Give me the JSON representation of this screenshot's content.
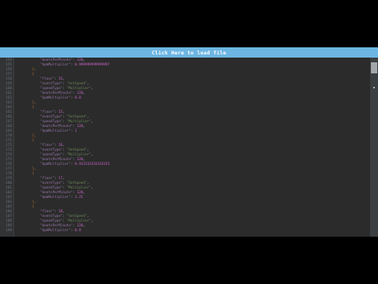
{
  "load_bar": {
    "label": "Click Here to load file"
  },
  "code_lines": [
    {
      "n": "154",
      "t": "            \"beatsPerMinute\": 120,"
    },
    {
      "n": "155",
      "t": "            \"bpmMultiplier\": 0.999999999999997"
    },
    {
      "n": "156",
      "t": "        },"
    },
    {
      "n": "157",
      "t": "        {"
    },
    {
      "n": "158",
      "t": "            \"floor\": 15,"
    },
    {
      "n": "159",
      "t": "            \"eventType\": \"SetSpeed\","
    },
    {
      "n": "160",
      "t": "            \"speedType\": \"Multiplier\","
    },
    {
      "n": "161",
      "t": "            \"beatsPerMinute\": 120,"
    },
    {
      "n": "162",
      "t": "            \"bpmMultiplier\": 0.8"
    },
    {
      "n": "163",
      "t": "        },"
    },
    {
      "n": "164",
      "t": "        {"
    },
    {
      "n": "165",
      "t": "            \"floor\": 15,"
    },
    {
      "n": "166",
      "t": "            \"eventType\": \"SetSpeed\","
    },
    {
      "n": "167",
      "t": "            \"speedType\": \"Multiplier\","
    },
    {
      "n": "168",
      "t": "            \"beatsPerMinute\": 120,"
    },
    {
      "n": "169",
      "t": "            \"bpmMultiplier\": 1"
    },
    {
      "n": "170",
      "t": "        },"
    },
    {
      "n": "171",
      "t": "        {"
    },
    {
      "n": "172",
      "t": "            \"floor\": 16,"
    },
    {
      "n": "173",
      "t": "            \"eventType\": \"SetSpeed\","
    },
    {
      "n": "174",
      "t": "            \"speedType\": \"Multiplier\","
    },
    {
      "n": "175",
      "t": "            \"beatsPerMinute\": 120,"
    },
    {
      "n": "176",
      "t": "            \"bpmMultiplier\": 0.933333333333333"
    },
    {
      "n": "177",
      "t": "        },"
    },
    {
      "n": "178",
      "t": "        {"
    },
    {
      "n": "179",
      "t": "            \"floor\": 17,"
    },
    {
      "n": "180",
      "t": "            \"eventType\": \"SetSpeed\","
    },
    {
      "n": "181",
      "t": "            \"speedType\": \"Multiplier\","
    },
    {
      "n": "182",
      "t": "            \"beatsPerMinute\": 120,"
    },
    {
      "n": "183",
      "t": "            \"bpmMultiplier\": 1.25"
    },
    {
      "n": "184",
      "t": "        },"
    },
    {
      "n": "185",
      "t": "        {"
    },
    {
      "n": "186",
      "t": "            \"floor\": 18,"
    },
    {
      "n": "187",
      "t": "            \"eventType\": \"SetSpeed\","
    },
    {
      "n": "188",
      "t": "            \"speedType\": \"Multiplier\","
    },
    {
      "n": "189",
      "t": "            \"beatsPerMinute\": 120,"
    },
    {
      "n": "190",
      "t": "            \"bpmMultiplier\": 0.8"
    }
  ]
}
